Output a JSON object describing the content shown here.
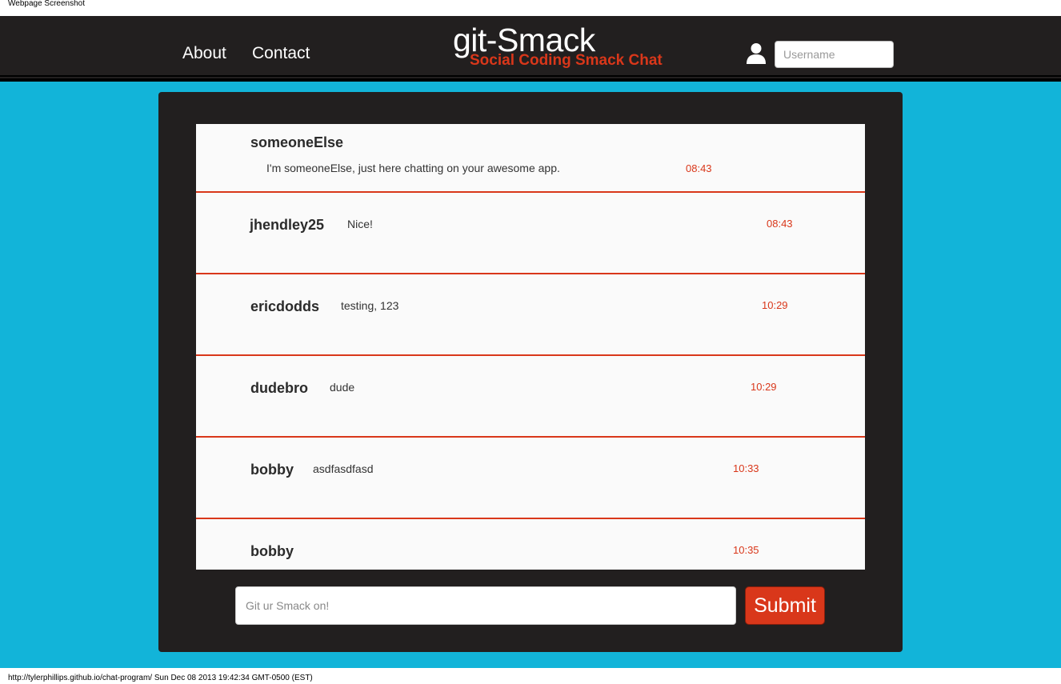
{
  "window": {
    "caption": "Webpage Screenshot"
  },
  "nav": {
    "about": "About",
    "contact": "Contact",
    "brand_title": "git-Smack",
    "brand_subtitle": "Social Coding Smack Chat",
    "username_placeholder": "Username",
    "user_icon": "user-silhouette-icon"
  },
  "messages": [
    {
      "user": "someoneElse",
      "text": "I'm someoneElse, just here chatting on your awesome app.",
      "time": "08:43"
    },
    {
      "user": "jhendley25",
      "text": "Nice!",
      "time": "08:43"
    },
    {
      "user": "ericdodds",
      "text": "testing, 123",
      "time": "10:29"
    },
    {
      "user": "dudebro",
      "text": "dude",
      "time": "10:29"
    },
    {
      "user": "bobby",
      "text": "asdfasdfasd",
      "time": "10:33"
    },
    {
      "user": "bobby",
      "text": "",
      "time": "10:35"
    }
  ],
  "composer": {
    "placeholder": "Git ur Smack on!",
    "submit_label": "Submit"
  },
  "footer": {
    "caption": "http://tylerphillips.github.io/chat-program/ Sun Dec 08 2013 19:42:34 GMT-0500 (EST)"
  },
  "colors": {
    "accent": "#d9371a",
    "background": "#12b4d9",
    "panel": "#221f1f"
  }
}
